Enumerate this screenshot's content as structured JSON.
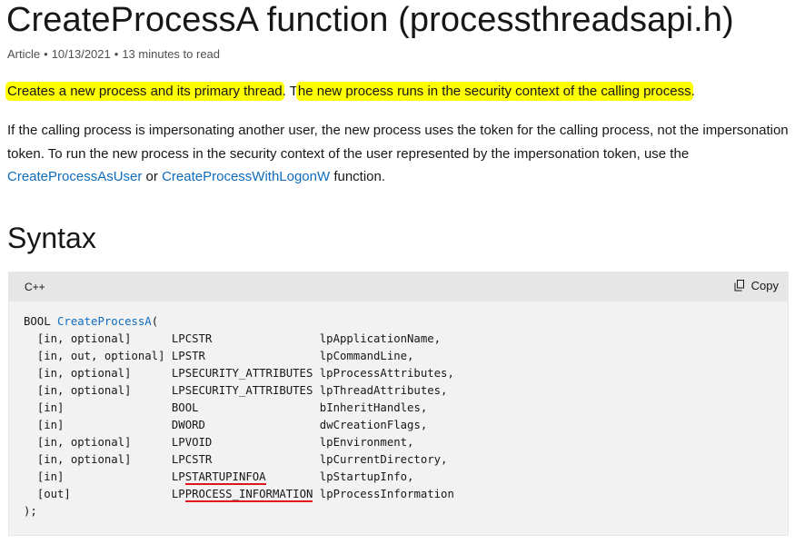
{
  "title": "CreateProcessA function (processthreadsapi.h)",
  "meta": {
    "type": "Article",
    "date": "10/13/2021",
    "read_time": "13 minutes to read"
  },
  "intro": {
    "hl1": "Creates a new process and its primary thread",
    "mid": ". T",
    "hl2": "he new process runs in the security context of the calling process",
    "end": "."
  },
  "para2": {
    "text1": "If the calling process is impersonating another user, the new process uses the token for the calling process, not the impersonation token. To run the new process in the security context of the user represented by the impersonation token, use the ",
    "link1": "CreateProcessAsUser",
    "text2": " or ",
    "link2": "CreateProcessWithLogonW",
    "text3": " function."
  },
  "syntax_heading": "Syntax",
  "code": {
    "language": "C++",
    "copy_label": "Copy",
    "open_prefix": "BOOL ",
    "function_name": "CreateProcessA",
    "open_suffix": "(",
    "lines": [
      {
        "annot": "[in, optional]",
        "type": "LPCSTR",
        "type_underline": "",
        "name": "lpApplicationName,"
      },
      {
        "annot": "[in, out, optional]",
        "type": "LPSTR",
        "type_underline": "",
        "name": "lpCommandLine,"
      },
      {
        "annot": "[in, optional]",
        "type": "LPSECURITY_ATTRIBUTES",
        "type_underline": "",
        "name": "lpProcessAttributes,"
      },
      {
        "annot": "[in, optional]",
        "type": "LPSECURITY_ATTRIBUTES",
        "type_underline": "",
        "name": "lpThreadAttributes,"
      },
      {
        "annot": "[in]",
        "type": "BOOL",
        "type_underline": "",
        "name": "bInheritHandles,"
      },
      {
        "annot": "[in]",
        "type": "DWORD",
        "type_underline": "",
        "name": "dwCreationFlags,"
      },
      {
        "annot": "[in, optional]",
        "type": "LPVOID",
        "type_underline": "",
        "name": "lpEnvironment,"
      },
      {
        "annot": "[in, optional]",
        "type": "LPCSTR",
        "type_underline": "",
        "name": "lpCurrentDirectory,"
      },
      {
        "annot": "[in]",
        "type": "LP",
        "type_underline": "STARTUPINFOA",
        "name": "lpStartupInfo,"
      },
      {
        "annot": "[out]",
        "type": "LP",
        "type_underline": "PROCESS_INFORMATION",
        "name": "lpProcessInformation"
      }
    ],
    "close": ");"
  },
  "colors": {
    "highlight": "#ffff00",
    "link": "#0f6cbd",
    "underline_mark": "#e0141e",
    "code_bg": "#f2f2f2",
    "code_header_bg": "#e6e6e6"
  },
  "icons": {
    "copy": "copy-icon"
  }
}
